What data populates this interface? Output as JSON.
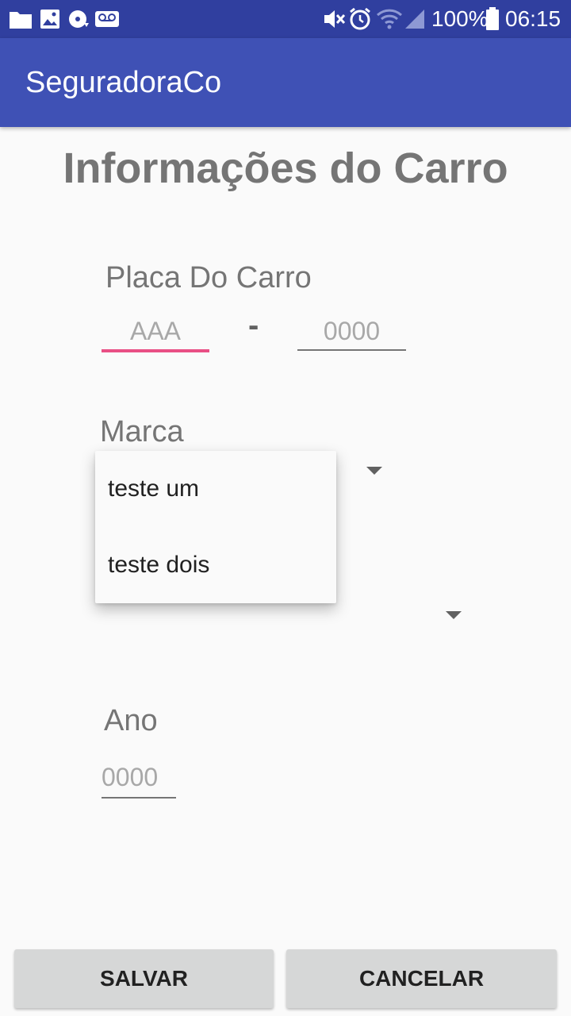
{
  "status_bar": {
    "battery": "100%",
    "time": "06:15",
    "left_icons": [
      "folder-icon",
      "image-icon",
      "sync-disc-icon",
      "voicemail-icon"
    ],
    "right_icons": [
      "mute-icon",
      "alarm-icon",
      "wifi-icon",
      "signal-icon",
      "battery-icon"
    ]
  },
  "app_bar": {
    "title": "SeguradoraCo"
  },
  "page": {
    "title": "Informações do Carro"
  },
  "plate": {
    "label": "Placa Do Carro",
    "letters_placeholder": "AAA",
    "separator": "-",
    "numbers_placeholder": "0000"
  },
  "brand": {
    "label": "Marca",
    "options": [
      "teste um",
      "teste dois"
    ]
  },
  "year": {
    "label": "Ano",
    "placeholder": "0000"
  },
  "buttons": {
    "save": "SALVAR",
    "cancel": "CANCELAR"
  },
  "colors": {
    "status_bar": "#303f9f",
    "app_bar": "#3f51b5",
    "accent": "#e94f85",
    "background": "#fafafa",
    "button": "#d6d7d7"
  }
}
